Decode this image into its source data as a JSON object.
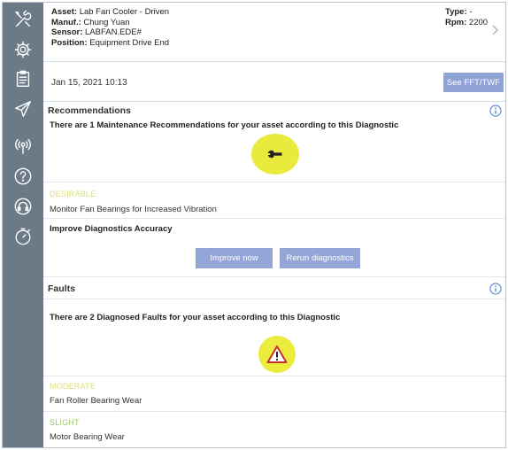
{
  "sidebar": {
    "icons": [
      "tools-icon",
      "gear-icon",
      "clipboard-icon",
      "send-icon",
      "signal-icon",
      "help-icon",
      "headset-icon",
      "timer-icon"
    ]
  },
  "header": {
    "asset_label": "Asset:",
    "asset_value": "Lab Fan Cooler - Driven",
    "manuf_label": "Manuf.:",
    "manuf_value": "Chung Yuan",
    "sensor_label": "Sensor:",
    "sensor_value": "LABFAN.EDE#",
    "position_label": "Position:",
    "position_value": "Equipment Drive End",
    "type_label": "Type:",
    "type_value": "-",
    "rpm_label": "Rpm:",
    "rpm_value": "2200"
  },
  "datebar": {
    "date": "Jan 15, 2021 10:13",
    "fft_button": "See FFT/TWF"
  },
  "recommendations": {
    "title": "Recommendations",
    "summary": "There are 1 Maintenance Recommendations for your asset according to this Diagnostic",
    "level": "DESIRABLE",
    "item": "Monitor Fan Bearings for Increased Vibration",
    "accuracy_title": "Improve Diagnostics Accuracy",
    "improve_button": "Improve now",
    "rerun_button": "Rerun diagnostics"
  },
  "faults": {
    "title": "Faults",
    "summary": "There are 2 Diagnosed Faults for your asset according to this Diagnostic",
    "items": [
      {
        "level": "MODERATE",
        "name": "Fan Roller Bearing Wear"
      },
      {
        "level": "SLIGHT",
        "name": "Motor Bearing Wear"
      }
    ]
  },
  "colors": {
    "sidebar": "#6c7a88",
    "button": "#94a5d7",
    "badge_yellow": "#e8eb3e",
    "info_blue": "#5b8bd6"
  }
}
